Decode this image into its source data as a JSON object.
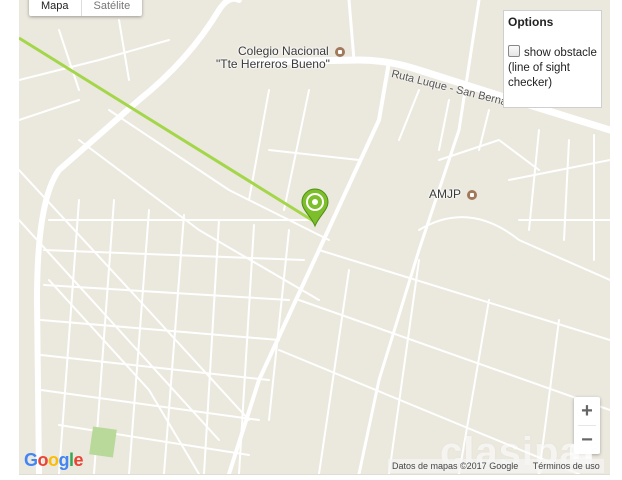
{
  "map": {
    "type_buttons": [
      "Mapa",
      "Satélite"
    ],
    "labels": {
      "college_line1": "Colegio Nacional",
      "college_line2": "\"Tte Herreros Bueno\"",
      "road": "Ruta Luque - San Berna",
      "poi": "AMJP"
    },
    "colors": {
      "land": "#ebe8de",
      "road": "#ffffff",
      "sight_line": "#a4d64a",
      "marker": "#7cbf2a",
      "park": "#b8d99a"
    },
    "icons": [
      "marker-icon",
      "poi-icon"
    ]
  },
  "options": {
    "title": "Options",
    "show_obstacle_label": "show obstacle",
    "show_obstacle_note": "(line of sight checker)",
    "show_obstacle_checked": false
  },
  "zoom": {
    "in": "+",
    "out": "−"
  },
  "footer": {
    "logo": "Google",
    "attribution": "Datos de mapas ©2017 Google",
    "terms": "Términos de uso"
  },
  "watermark": "clasipar"
}
